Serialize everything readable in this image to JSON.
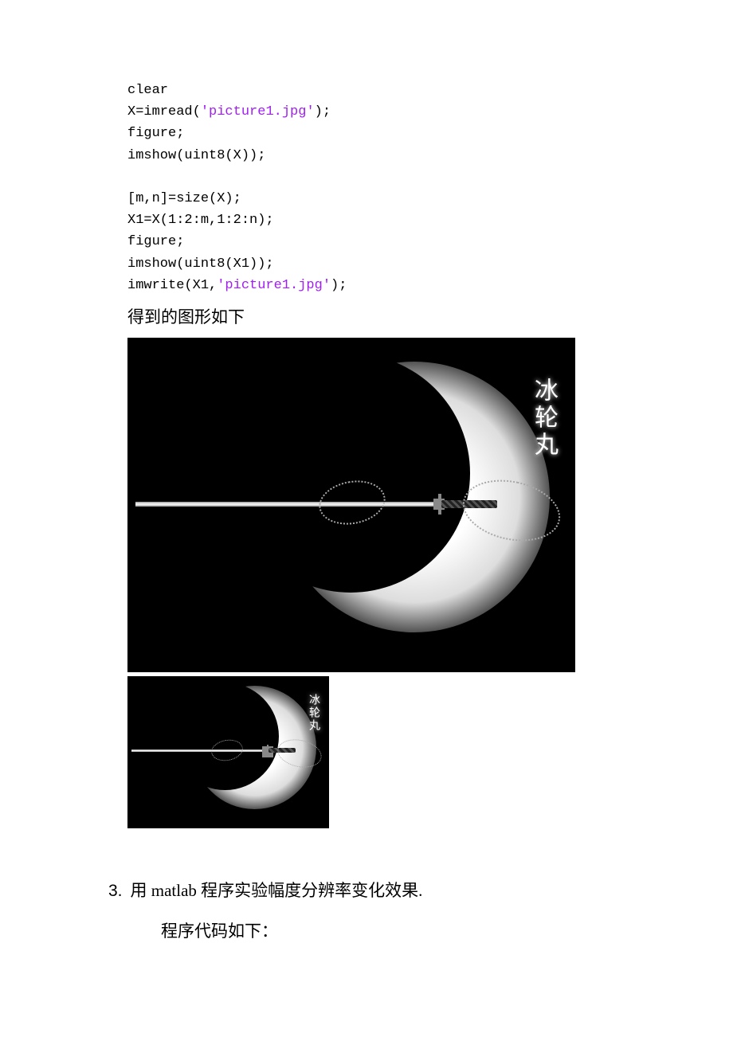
{
  "code": {
    "l1": "clear",
    "l2a": "X=imread(",
    "l2s": "'picture1.jpg'",
    "l2b": ");",
    "l3": "figure;",
    "l4": "imshow(uint8(X));",
    "l5": "[m,n]=size(X);",
    "l6": "X1=X(1:2:m,1:2:n);",
    "l7": "figure;",
    "l8": "imshow(uint8(X1));",
    "l9a": "imwrite(X1,",
    "l9s": "'picture1.jpg'",
    "l9b": ");"
  },
  "text": {
    "result_caption": "得到的图形如下",
    "signature_large": "冰轮丸",
    "signature_small": "冰轮丸",
    "q3_num": "3.",
    "q3_text": "用 matlab 程序实验幅度分辨率变化效果.",
    "q3_sub": "程序代码如下："
  }
}
